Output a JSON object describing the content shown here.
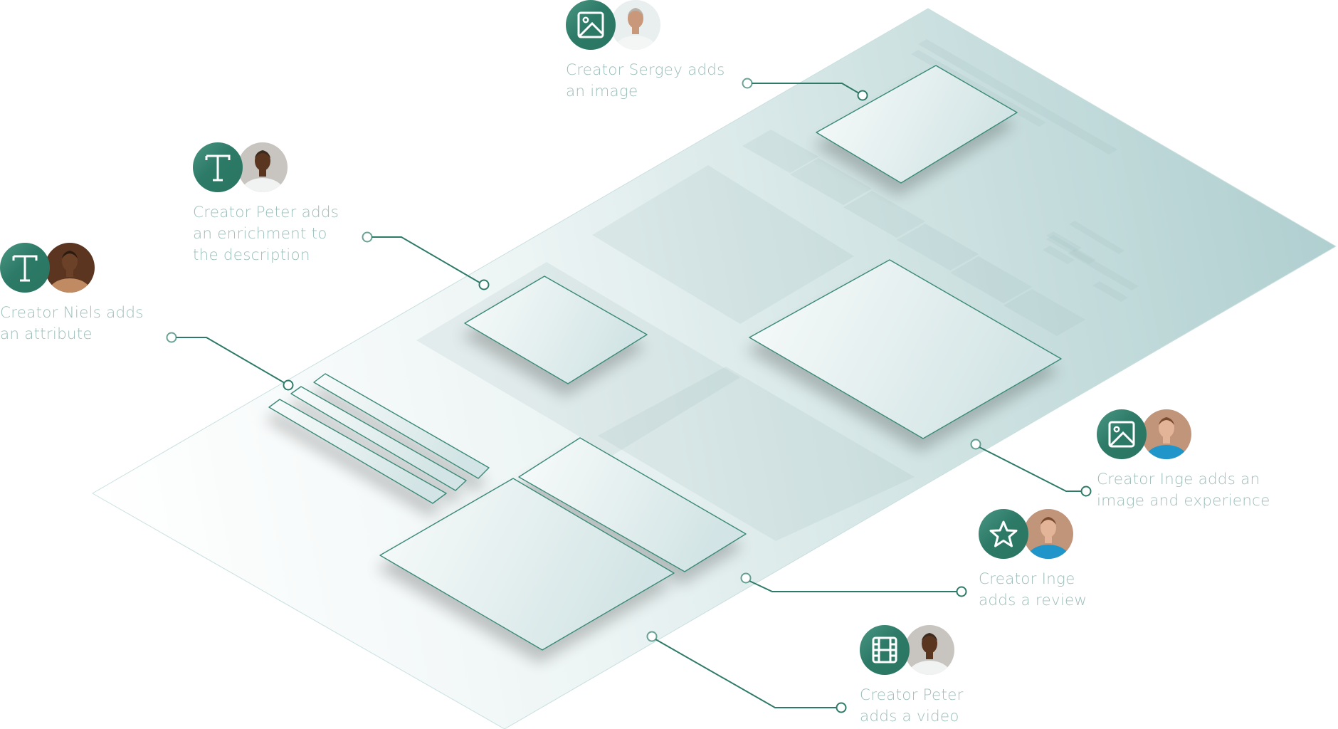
{
  "colors": {
    "accent": "#2c7a67",
    "line": "#2e7a68",
    "caption_text": "#9dbfbb",
    "plane_light": "#f7fafa",
    "plane_dark": "#b4d2d3",
    "card_stroke": "#3b8a78"
  },
  "annotations": [
    {
      "id": "sergey-image",
      "icon": "image-icon",
      "creator": "Sergey",
      "avatar": "avatar-sergey",
      "caption_lines": [
        "Creator Sergey adds",
        "an image"
      ]
    },
    {
      "id": "peter-enrichment",
      "icon": "text-icon",
      "creator": "Peter",
      "avatar": "avatar-peter",
      "caption_lines": [
        "Creator Peter adds",
        "an enrichment to",
        "the description"
      ]
    },
    {
      "id": "niels-attribute",
      "icon": "text-icon",
      "creator": "Niels",
      "avatar": "avatar-niels",
      "caption_lines": [
        "Creator Niels adds",
        "an attribute"
      ]
    },
    {
      "id": "inge-image-experience",
      "icon": "image-icon",
      "creator": "Inge",
      "avatar": "avatar-inge",
      "caption_lines": [
        "Creator Inge adds an",
        "image and experience"
      ]
    },
    {
      "id": "inge-review",
      "icon": "star-icon",
      "creator": "Inge",
      "avatar": "avatar-inge",
      "caption_lines": [
        "Creator Inge",
        "adds a review"
      ]
    },
    {
      "id": "peter-video",
      "icon": "film-icon",
      "creator": "Peter",
      "avatar": "avatar-peter",
      "caption_lines": [
        "Creator Peter",
        "adds a video"
      ]
    }
  ]
}
